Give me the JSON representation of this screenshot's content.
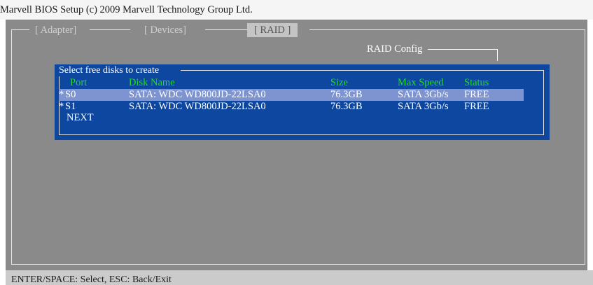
{
  "window": {
    "title": "Marvell BIOS Setup (c) 2009 Marvell Technology Group Ltd."
  },
  "tabs": [
    {
      "label": "[ Adapter]",
      "active": false
    },
    {
      "label": "[ Devices]",
      "active": false
    },
    {
      "label": "[ RAID ]",
      "active": true
    }
  ],
  "raid_config": {
    "label": "RAID Config"
  },
  "disk_dialog": {
    "title": "Select free disks to create",
    "headers": {
      "port": "Port",
      "disk_name": "Disk Name",
      "size": "Size",
      "max_speed": "Max Speed",
      "status": "Status"
    },
    "rows": [
      {
        "marker": "*",
        "port": "S0",
        "disk_name": "SATA: WDC WD800JD-22LSA0",
        "size": "76.3GB",
        "max_speed": "SATA 3Gb/s",
        "status": "FREE",
        "selected": true
      },
      {
        "marker": "*",
        "port": "S1",
        "disk_name": "SATA: WDC WD800JD-22LSA0",
        "size": "76.3GB",
        "max_speed": "SATA 3Gb/s",
        "status": "FREE",
        "selected": false
      }
    ],
    "next_label": "NEXT"
  },
  "status_bar": {
    "text": "ENTER/SPACE: Select, ESC: Back/Exit"
  },
  "colors": {
    "screen_bg": "#8a8a8a",
    "dialog_bg": "#0d47a0",
    "header_text": "#22dd22",
    "selected_row": "#7d94d0"
  }
}
